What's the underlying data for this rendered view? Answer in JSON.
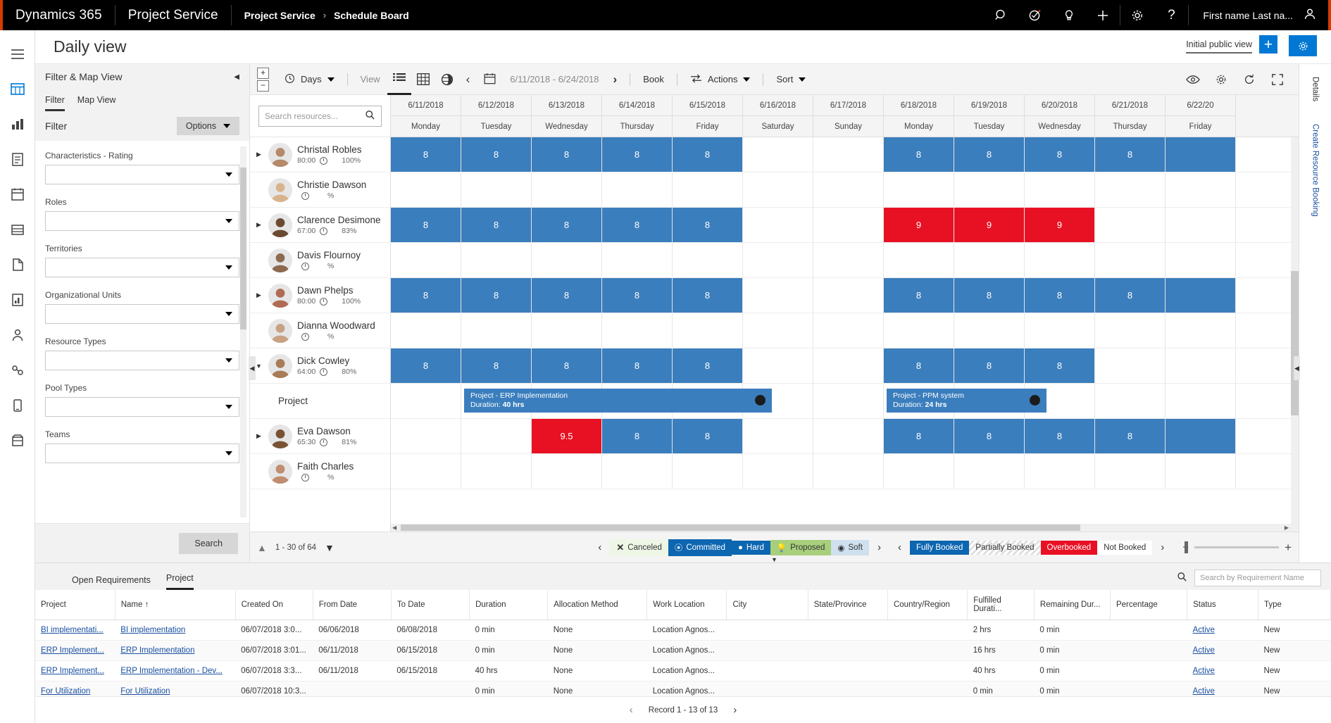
{
  "topbar": {
    "brand": "Dynamics 365",
    "app": "Project Service",
    "breadcrumb": [
      "Project Service",
      "Schedule Board"
    ],
    "breadcrumb_sep": "›",
    "icons": [
      "search-icon",
      "assistant-icon",
      "ideas-icon",
      "add-icon",
      "settings-icon",
      "help-icon"
    ],
    "user_name": "First name Last na...",
    "accent_color": "#d83b01"
  },
  "page": {
    "title": "Daily view",
    "view_name": "Initial public view",
    "add_view_label": "+",
    "settings_icon": "gear-icon"
  },
  "filter_panel": {
    "header": "Filter & Map View",
    "collapse_icon": "chevron-left-icon",
    "tabs": [
      {
        "label": "Filter",
        "selected": true
      },
      {
        "label": "Map View",
        "selected": false
      }
    ],
    "section_label": "Filter",
    "options_button": "Options",
    "fields": [
      {
        "label": "Characteristics - Rating",
        "value": ""
      },
      {
        "label": "Roles",
        "value": ""
      },
      {
        "label": "Territories",
        "value": ""
      },
      {
        "label": "Organizational Units",
        "value": ""
      },
      {
        "label": "Resource Types",
        "value": ""
      },
      {
        "label": "Pool Types",
        "value": ""
      },
      {
        "label": "Teams",
        "value": ""
      }
    ],
    "search_button": "Search"
  },
  "board_toolbar": {
    "zoom_in": "+",
    "zoom_out": "−",
    "scale_label": "Days",
    "view_label": "View",
    "view_icons": [
      "list-view-icon",
      "grid-view-icon",
      "map-view-icon"
    ],
    "prev_icon": "chevron-left-icon",
    "calendar_icon": "calendar-icon",
    "date_range": "6/11/2018 - 6/24/2018",
    "next_icon": "chevron-right-icon",
    "book_label": "Book",
    "actions_label": "Actions",
    "sort_label": "Sort",
    "right_icons": [
      "eye-icon",
      "gear-icon",
      "refresh-icon",
      "fullscreen-icon"
    ]
  },
  "resources": {
    "search_placeholder": "Search resources...",
    "search_icon": "search-icon",
    "rows": [
      {
        "type": "resource",
        "name": "Christal Robles",
        "hours": "80:00",
        "pct": "100%",
        "expandable": true,
        "expanded": false,
        "avatar_color": "#b5896a"
      },
      {
        "type": "resource",
        "name": "Christie Dawson",
        "hours": "",
        "pct": "",
        "expandable": false,
        "expanded": false,
        "avatar_color": "#d8b48e"
      },
      {
        "type": "resource",
        "name": "Clarence Desimone",
        "hours": "67:00",
        "pct": "83%",
        "expandable": true,
        "expanded": false,
        "avatar_color": "#6b4a32"
      },
      {
        "type": "resource",
        "name": "Davis Flournoy",
        "hours": "",
        "pct": "",
        "expandable": false,
        "expanded": false,
        "avatar_color": "#8d6a4f"
      },
      {
        "type": "resource",
        "name": "Dawn Phelps",
        "hours": "80:00",
        "pct": "100%",
        "expandable": true,
        "expanded": false,
        "avatar_color": "#b06b55"
      },
      {
        "type": "resource",
        "name": "Dianna Woodward",
        "hours": "",
        "pct": "",
        "expandable": false,
        "expanded": false,
        "avatar_color": "#c9a183"
      },
      {
        "type": "resource",
        "name": "Dick Cowley",
        "hours": "64:00",
        "pct": "80%",
        "expandable": true,
        "expanded": true,
        "avatar_color": "#a97b57"
      },
      {
        "type": "sub",
        "name": "Project",
        "hours": "",
        "pct": "",
        "expandable": false,
        "expanded": false,
        "avatar_color": ""
      },
      {
        "type": "resource",
        "name": "Eva Dawson",
        "hours": "65:30",
        "pct": "81%",
        "expandable": true,
        "expanded": false,
        "avatar_color": "#7a5236"
      },
      {
        "type": "resource",
        "name": "Faith Charles",
        "hours": "",
        "pct": "",
        "expandable": false,
        "expanded": false,
        "avatar_color": "#c08d70"
      }
    ]
  },
  "schedule": {
    "columns": [
      {
        "date": "6/11/2018",
        "day": "Monday"
      },
      {
        "date": "6/12/2018",
        "day": "Tuesday"
      },
      {
        "date": "6/13/2018",
        "day": "Wednesday"
      },
      {
        "date": "6/14/2018",
        "day": "Thursday"
      },
      {
        "date": "6/15/2018",
        "day": "Friday"
      },
      {
        "date": "6/16/2018",
        "day": "Saturday"
      },
      {
        "date": "6/17/2018",
        "day": "Sunday"
      },
      {
        "date": "6/18/2018",
        "day": "Monday"
      },
      {
        "date": "6/19/2018",
        "day": "Tuesday"
      },
      {
        "date": "6/20/2018",
        "day": "Wednesday"
      },
      {
        "date": "6/21/2018",
        "day": "Thursday"
      },
      {
        "date": "6/22/20",
        "day": "Friday"
      }
    ],
    "rows": [
      {
        "cells": [
          {
            "v": "8",
            "s": "full"
          },
          {
            "v": "8",
            "s": "full"
          },
          {
            "v": "8",
            "s": "full"
          },
          {
            "v": "8",
            "s": "full"
          },
          {
            "v": "8",
            "s": "full"
          },
          {
            "v": "",
            "s": "none"
          },
          {
            "v": "",
            "s": "none"
          },
          {
            "v": "8",
            "s": "full"
          },
          {
            "v": "8",
            "s": "full"
          },
          {
            "v": "8",
            "s": "full"
          },
          {
            "v": "8",
            "s": "full"
          },
          {
            "v": "",
            "s": "full"
          }
        ]
      },
      {
        "cells": [
          {
            "v": "",
            "s": "none"
          },
          {
            "v": "",
            "s": "none"
          },
          {
            "v": "",
            "s": "none"
          },
          {
            "v": "",
            "s": "none"
          },
          {
            "v": "",
            "s": "none"
          },
          {
            "v": "",
            "s": "none"
          },
          {
            "v": "",
            "s": "none"
          },
          {
            "v": "",
            "s": "none"
          },
          {
            "v": "",
            "s": "none"
          },
          {
            "v": "",
            "s": "none"
          },
          {
            "v": "",
            "s": "none"
          },
          {
            "v": "",
            "s": "none"
          }
        ]
      },
      {
        "cells": [
          {
            "v": "8",
            "s": "full"
          },
          {
            "v": "8",
            "s": "full"
          },
          {
            "v": "8",
            "s": "full"
          },
          {
            "v": "8",
            "s": "full"
          },
          {
            "v": "8",
            "s": "full"
          },
          {
            "v": "",
            "s": "none"
          },
          {
            "v": "",
            "s": "none"
          },
          {
            "v": "9",
            "s": "over"
          },
          {
            "v": "9",
            "s": "over"
          },
          {
            "v": "9",
            "s": "over"
          },
          {
            "v": "",
            "s": "none"
          },
          {
            "v": "",
            "s": "none"
          }
        ]
      },
      {
        "cells": [
          {
            "v": "",
            "s": "none"
          },
          {
            "v": "",
            "s": "none"
          },
          {
            "v": "",
            "s": "none"
          },
          {
            "v": "",
            "s": "none"
          },
          {
            "v": "",
            "s": "none"
          },
          {
            "v": "",
            "s": "none"
          },
          {
            "v": "",
            "s": "none"
          },
          {
            "v": "",
            "s": "none"
          },
          {
            "v": "",
            "s": "none"
          },
          {
            "v": "",
            "s": "none"
          },
          {
            "v": "",
            "s": "none"
          },
          {
            "v": "",
            "s": "none"
          }
        ]
      },
      {
        "cells": [
          {
            "v": "8",
            "s": "full"
          },
          {
            "v": "8",
            "s": "full"
          },
          {
            "v": "8",
            "s": "full"
          },
          {
            "v": "8",
            "s": "full"
          },
          {
            "v": "8",
            "s": "full"
          },
          {
            "v": "",
            "s": "none"
          },
          {
            "v": "",
            "s": "none"
          },
          {
            "v": "8",
            "s": "full"
          },
          {
            "v": "8",
            "s": "full"
          },
          {
            "v": "8",
            "s": "full"
          },
          {
            "v": "8",
            "s": "full"
          },
          {
            "v": "",
            "s": "full"
          }
        ]
      },
      {
        "cells": [
          {
            "v": "",
            "s": "none"
          },
          {
            "v": "",
            "s": "none"
          },
          {
            "v": "",
            "s": "none"
          },
          {
            "v": "",
            "s": "none"
          },
          {
            "v": "",
            "s": "none"
          },
          {
            "v": "",
            "s": "none"
          },
          {
            "v": "",
            "s": "none"
          },
          {
            "v": "",
            "s": "none"
          },
          {
            "v": "",
            "s": "none"
          },
          {
            "v": "",
            "s": "none"
          },
          {
            "v": "",
            "s": "none"
          },
          {
            "v": "",
            "s": "none"
          }
        ]
      },
      {
        "cells": [
          {
            "v": "8",
            "s": "full"
          },
          {
            "v": "8",
            "s": "full"
          },
          {
            "v": "8",
            "s": "full"
          },
          {
            "v": "8",
            "s": "full"
          },
          {
            "v": "8",
            "s": "full"
          },
          {
            "v": "",
            "s": "none"
          },
          {
            "v": "",
            "s": "none"
          },
          {
            "v": "8",
            "s": "full"
          },
          {
            "v": "8",
            "s": "full"
          },
          {
            "v": "8",
            "s": "full"
          },
          {
            "v": "",
            "s": "none"
          },
          {
            "v": "",
            "s": "none"
          }
        ]
      },
      {
        "cells": [
          {
            "v": "",
            "s": "none"
          },
          {
            "v": "",
            "s": "none"
          },
          {
            "v": "",
            "s": "none"
          },
          {
            "v": "",
            "s": "none"
          },
          {
            "v": "",
            "s": "none"
          },
          {
            "v": "",
            "s": "none"
          },
          {
            "v": "",
            "s": "none"
          },
          {
            "v": "",
            "s": "none"
          },
          {
            "v": "",
            "s": "none"
          },
          {
            "v": "",
            "s": "none"
          },
          {
            "v": "",
            "s": "none"
          },
          {
            "v": "",
            "s": "none"
          }
        ]
      },
      {
        "cells": [
          {
            "v": "",
            "s": "none"
          },
          {
            "v": "",
            "s": "none"
          },
          {
            "v": "9.5",
            "s": "over"
          },
          {
            "v": "8",
            "s": "full"
          },
          {
            "v": "8",
            "s": "full"
          },
          {
            "v": "",
            "s": "none"
          },
          {
            "v": "",
            "s": "none"
          },
          {
            "v": "8",
            "s": "full"
          },
          {
            "v": "8",
            "s": "full"
          },
          {
            "v": "8",
            "s": "full"
          },
          {
            "v": "8",
            "s": "full"
          },
          {
            "v": "",
            "s": "full"
          }
        ]
      },
      {
        "cells": [
          {
            "v": "",
            "s": "none"
          },
          {
            "v": "",
            "s": "none"
          },
          {
            "v": "",
            "s": "none"
          },
          {
            "v": "",
            "s": "none"
          },
          {
            "v": "",
            "s": "none"
          },
          {
            "v": "",
            "s": "none"
          },
          {
            "v": "",
            "s": "none"
          },
          {
            "v": "",
            "s": "none"
          },
          {
            "v": "",
            "s": "none"
          },
          {
            "v": "",
            "s": "none"
          },
          {
            "v": "",
            "s": "none"
          },
          {
            "v": "",
            "s": "none"
          }
        ]
      }
    ],
    "project_bars": [
      {
        "row": 7,
        "start_col": 1,
        "span_cols": 4.45,
        "title": "Project - ERP Implementation",
        "duration_label": "Duration:",
        "duration_value": "40 hrs"
      },
      {
        "row": 7,
        "start_col": 7.0,
        "span_cols": 2.35,
        "title": "Project - PPM system",
        "duration_label": "Duration:",
        "duration_value": "24 hrs"
      }
    ]
  },
  "board_footer": {
    "pager_text": "1 - 30 of 64",
    "up_icon": "chevron-up-icon",
    "down_icon": "chevron-down-icon",
    "legend_prev": "chevron-left-icon",
    "legend_next": "chevron-right-icon",
    "booking_status": [
      {
        "label": "Canceled",
        "cls": "cancel",
        "icon": "x-icon"
      },
      {
        "label": "Committed",
        "cls": "commit",
        "icon": "committed-icon"
      },
      {
        "label": "Hard",
        "cls": "hard",
        "icon": "filled-circle-icon"
      },
      {
        "label": "Proposed",
        "cls": "prop",
        "icon": "bulb-icon"
      },
      {
        "label": "Soft",
        "cls": "soft",
        "icon": "ring-circle-icon"
      }
    ],
    "capacity": [
      {
        "label": "Fully Booked",
        "cls": "fully"
      },
      {
        "label": "Partially Booked",
        "cls": "partial"
      },
      {
        "label": "Overbooked",
        "cls": "over"
      },
      {
        "label": "Not Booked",
        "cls": "not"
      }
    ],
    "zoom_out": "−",
    "zoom_in": "+"
  },
  "bottom_grid": {
    "tabs": [
      {
        "label": "Open Requirements",
        "selected": false
      },
      {
        "label": "Project",
        "selected": true
      }
    ],
    "search_icon": "search-icon",
    "search_placeholder": "Search by Requirement Name",
    "sort_indicator": "↑",
    "columns": [
      "Project",
      "Name",
      "Created On",
      "From Date",
      "To Date",
      "Duration",
      "Allocation Method",
      "Work Location",
      "City",
      "State/Province",
      "Country/Region",
      "Fulfilled Durati...",
      "Remaining Dur...",
      "Percentage",
      "Status",
      "Type"
    ],
    "sorted_column": "Name",
    "rows": [
      {
        "project": "BI implementati...",
        "name": "BI implementation",
        "created": "06/07/2018 3:0...",
        "from": "06/06/2018",
        "to": "06/08/2018",
        "duration": "0 min",
        "alloc": "None",
        "work_loc": "Location Agnos...",
        "city": "",
        "state": "",
        "country": "",
        "fulfilled": "2 hrs",
        "remaining": "0 min",
        "percentage": "",
        "status": "Active",
        "type": "New"
      },
      {
        "project": "ERP Implement...",
        "name": "ERP Implementation",
        "created": "06/07/2018 3:01...",
        "from": "06/11/2018",
        "to": "06/15/2018",
        "duration": "0 min",
        "alloc": "None",
        "work_loc": "Location Agnos...",
        "city": "",
        "state": "",
        "country": "",
        "fulfilled": "16 hrs",
        "remaining": "0 min",
        "percentage": "",
        "status": "Active",
        "type": "New"
      },
      {
        "project": "ERP Implement...",
        "name": "ERP Implementation - Dev...",
        "created": "06/07/2018 3:3...",
        "from": "06/11/2018",
        "to": "06/15/2018",
        "duration": "40 hrs",
        "alloc": "None",
        "work_loc": "Location Agnos...",
        "city": "",
        "state": "",
        "country": "",
        "fulfilled": "40 hrs",
        "remaining": "0 min",
        "percentage": "",
        "status": "Active",
        "type": "New"
      },
      {
        "project": "For Utilization",
        "name": "For Utilization",
        "created": "06/07/2018 10:3...",
        "from": "",
        "to": "",
        "duration": "0 min",
        "alloc": "None",
        "work_loc": "Location Agnos...",
        "city": "",
        "state": "",
        "country": "",
        "fulfilled": "0 min",
        "remaining": "0 min",
        "percentage": "",
        "status": "Active",
        "type": "New"
      }
    ],
    "record_pager": "Record 1 - 13 of 13",
    "prev_icon": "chevron-left-icon",
    "next_icon": "chevron-right-icon"
  },
  "details_rail": {
    "label_top": "Details",
    "label_bottom": "Create Resource Booking",
    "collapse_icon": "chevron-left-icon"
  },
  "colors": {
    "accent": "#d83b01",
    "primary_blue": "#0078d4",
    "booked_blue": "#3b7ebd",
    "legend_blue": "#0d66b0",
    "overbooked_red": "#e81123",
    "proposed_green": "#a8cf7c",
    "soft_blue": "#cfe0ef",
    "link_blue": "#1a50a0"
  }
}
